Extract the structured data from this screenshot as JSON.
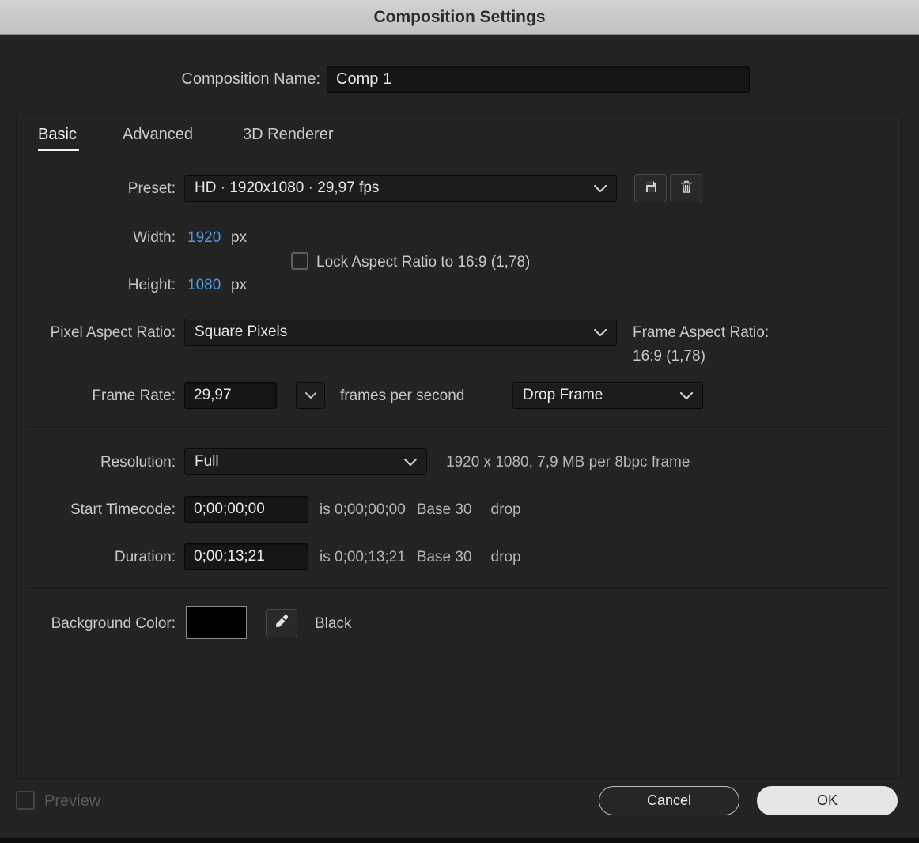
{
  "window": {
    "title": "Composition Settings"
  },
  "composition_name": {
    "label": "Composition Name:",
    "value": "Comp 1"
  },
  "tabs": [
    {
      "label": "Basic",
      "active": true
    },
    {
      "label": "Advanced",
      "active": false
    },
    {
      "label": "3D Renderer",
      "active": false
    }
  ],
  "preset": {
    "label": "Preset:",
    "value": "HD  ·  1920x1080 · 29,97 fps"
  },
  "dimensions": {
    "width_label": "Width:",
    "width_value": "1920",
    "width_unit": "px",
    "height_label": "Height:",
    "height_value": "1080",
    "height_unit": "px",
    "lock_aspect_label": "Lock Aspect Ratio to 16:9 (1,78)",
    "lock_aspect_checked": false
  },
  "pixel_aspect_ratio": {
    "label": "Pixel Aspect Ratio:",
    "value": "Square Pixels"
  },
  "frame_aspect_ratio": {
    "label": "Frame Aspect Ratio:",
    "value": "16:9 (1,78)"
  },
  "frame_rate": {
    "label": "Frame Rate:",
    "value": "29,97",
    "unit": "frames per second",
    "dropdown_value": "Drop Frame"
  },
  "resolution": {
    "label": "Resolution:",
    "value": "Full",
    "info": "1920 x 1080, 7,9 MB per 8bpc frame"
  },
  "start_timecode": {
    "label": "Start Timecode:",
    "value": "0;00;00;00",
    "info_is": "is 0;00;00;00",
    "base": "Base 30",
    "drop": "drop"
  },
  "duration": {
    "label": "Duration:",
    "value": "0;00;13;21",
    "info_is": "is 0;00;13;21",
    "base": "Base 30",
    "drop": "drop"
  },
  "background_color": {
    "label": "Background Color:",
    "swatch_color": "#000000",
    "value_name": "Black"
  },
  "footer": {
    "preview_label": "Preview",
    "preview_checked": false,
    "cancel_label": "Cancel",
    "ok_label": "OK"
  },
  "colors": {
    "accent_blue": "#4d9be6",
    "dialog_bg": "#232323",
    "titlebar_bg": "#c9c9c9"
  }
}
